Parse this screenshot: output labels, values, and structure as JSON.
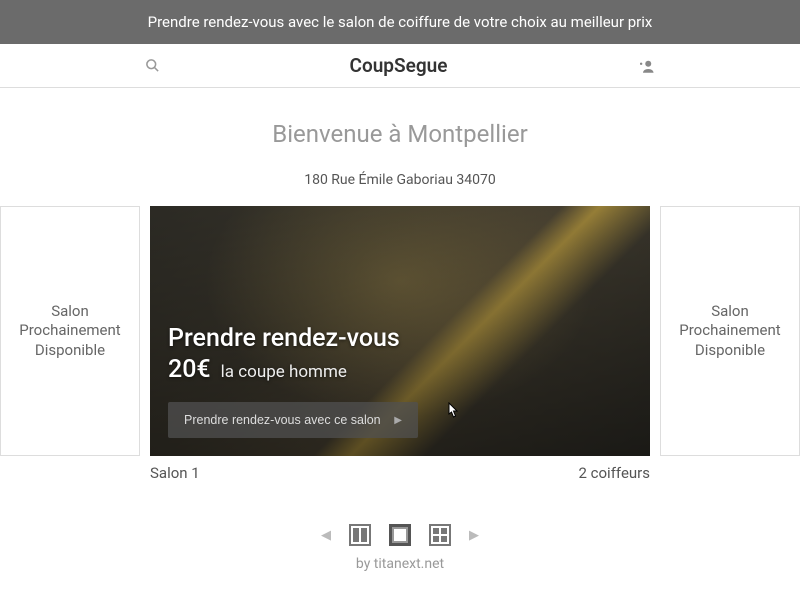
{
  "banner": "Prendre rendez-vous avec le salon de coiffure de votre choix au meilleur prix",
  "brand": "CoupSegue",
  "welcome": "Bienvenue à Montpellier",
  "address": "180 Rue Émile Gaboriau 34070",
  "side": {
    "left": "Salon Prochainement Disponible",
    "right": "Salon Prochainement Disponible"
  },
  "card": {
    "title": "Prendre rendez-vous",
    "price": "20€",
    "service": "la coupe homme",
    "button": "Prendre rendez-vous avec ce salon"
  },
  "meta": {
    "name": "Salon 1",
    "staff": "2 coiffeurs"
  },
  "credit": "by titanext.net"
}
